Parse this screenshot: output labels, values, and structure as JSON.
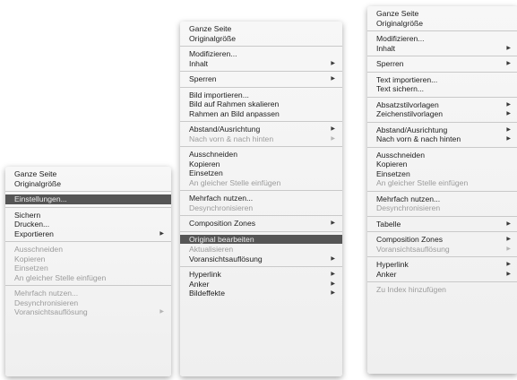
{
  "menus": [
    {
      "groups": [
        [
          {
            "label": "Ganze Seite"
          },
          {
            "label": "Originalgröße"
          }
        ],
        [
          {
            "label": "Einstellungen...",
            "highlighted": true
          }
        ],
        [
          {
            "label": "Sichern"
          },
          {
            "label": "Drucken..."
          },
          {
            "label": "Exportieren",
            "submenu": true
          }
        ],
        [
          {
            "label": "Ausschneiden",
            "disabled": true
          },
          {
            "label": "Kopieren",
            "disabled": true
          },
          {
            "label": "Einsetzen",
            "disabled": true
          },
          {
            "label": "An gleicher Stelle einfügen",
            "disabled": true
          }
        ],
        [
          {
            "label": "Mehrfach nutzen...",
            "disabled": true
          },
          {
            "label": "Desynchronisieren",
            "disabled": true
          },
          {
            "label": "Voransichtsauflösung",
            "disabled": true,
            "submenu": true
          }
        ]
      ]
    },
    {
      "groups": [
        [
          {
            "label": "Ganze Seite"
          },
          {
            "label": "Originalgröße"
          }
        ],
        [
          {
            "label": "Modifizieren..."
          },
          {
            "label": "Inhalt",
            "submenu": true
          }
        ],
        [
          {
            "label": "Sperren",
            "submenu": true
          }
        ],
        [
          {
            "label": "Bild importieren..."
          },
          {
            "label": "Bild auf Rahmen skalieren"
          },
          {
            "label": "Rahmen an Bild anpassen"
          }
        ],
        [
          {
            "label": "Abstand/Ausrichtung",
            "submenu": true
          },
          {
            "label": "Nach vorn & nach hinten",
            "disabled": true,
            "submenu": true
          }
        ],
        [
          {
            "label": "Ausschneiden"
          },
          {
            "label": "Kopieren"
          },
          {
            "label": "Einsetzen"
          },
          {
            "label": "An gleicher Stelle einfügen",
            "disabled": true
          }
        ],
        [
          {
            "label": "Mehrfach nutzen..."
          },
          {
            "label": "Desynchronisieren",
            "disabled": true
          }
        ],
        [
          {
            "label": "Composition Zones",
            "submenu": true
          }
        ],
        [
          {
            "label": "Original bearbeiten",
            "highlighted": true
          },
          {
            "label": "Aktualisieren",
            "disabled": true
          },
          {
            "label": "Voransichtsauflösung",
            "submenu": true
          }
        ],
        [
          {
            "label": "Hyperlink",
            "submenu": true
          },
          {
            "label": "Anker",
            "submenu": true
          },
          {
            "label": "Bildeffekte",
            "submenu": true
          }
        ]
      ]
    },
    {
      "groups": [
        [
          {
            "label": "Ganze Seite"
          },
          {
            "label": "Originalgröße"
          }
        ],
        [
          {
            "label": "Modifizieren..."
          },
          {
            "label": "Inhalt",
            "submenu": true
          }
        ],
        [
          {
            "label": "Sperren",
            "submenu": true
          }
        ],
        [
          {
            "label": "Text importieren..."
          },
          {
            "label": "Text sichern..."
          }
        ],
        [
          {
            "label": "Absatzstilvorlagen",
            "submenu": true
          },
          {
            "label": "Zeichenstilvorlagen",
            "submenu": true
          }
        ],
        [
          {
            "label": "Abstand/Ausrichtung",
            "submenu": true
          },
          {
            "label": "Nach vorn & nach hinten",
            "submenu": true
          }
        ],
        [
          {
            "label": "Ausschneiden"
          },
          {
            "label": "Kopieren"
          },
          {
            "label": "Einsetzen"
          },
          {
            "label": "An gleicher Stelle einfügen",
            "disabled": true
          }
        ],
        [
          {
            "label": "Mehrfach nutzen..."
          },
          {
            "label": "Desynchronisieren",
            "disabled": true
          }
        ],
        [
          {
            "label": "Tabelle",
            "submenu": true
          }
        ],
        [
          {
            "label": "Composition Zones",
            "submenu": true
          },
          {
            "label": "Voransichtsauflösung",
            "disabled": true,
            "submenu": true
          }
        ],
        [
          {
            "label": "Hyperlink",
            "submenu": true
          },
          {
            "label": "Anker",
            "submenu": true
          }
        ],
        [
          {
            "label": "Zu Index hinzufügen",
            "disabled": true
          }
        ]
      ]
    }
  ],
  "icons": {
    "submenu_arrow": "submenu-arrow-icon"
  },
  "colors": {
    "highlight": "#555555",
    "disabled_text": "#9b9b9b"
  }
}
